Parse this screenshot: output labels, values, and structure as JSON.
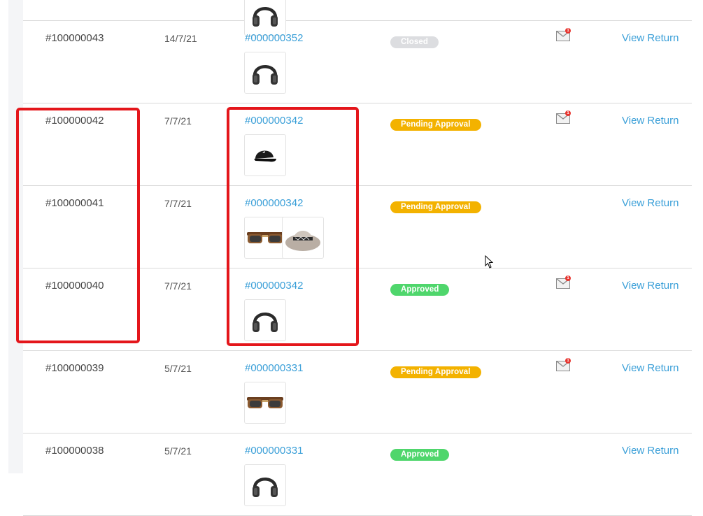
{
  "colors": {
    "link": "#3a9fd8",
    "closed": "#dcdde0",
    "pending": "#f3b200",
    "approved": "#4fd66c",
    "highlight": "#e4161b"
  },
  "rows": [
    {
      "id": "",
      "date": "",
      "order": "",
      "status": "",
      "status_type": "none",
      "mail": false,
      "view": "",
      "products": [
        "headphones-icon"
      ]
    },
    {
      "id": "#100000043",
      "date": "14/7/21",
      "order": "#000000352",
      "status": "Closed",
      "status_type": "closed",
      "mail": true,
      "view": "View Return",
      "products": [
        "headphones-icon"
      ]
    },
    {
      "id": "#100000042",
      "date": "7/7/21",
      "order": "#000000342",
      "status": "Pending Approval",
      "status_type": "pending",
      "mail": true,
      "view": "View Return",
      "products": [
        "cap-icon"
      ]
    },
    {
      "id": "#100000041",
      "date": "7/7/21",
      "order": "#000000342",
      "status": "Pending Approval",
      "status_type": "pending",
      "mail": false,
      "view": "View Return",
      "products": [
        "sunglasses-icon",
        "sun-hat-icon"
      ]
    },
    {
      "id": "#100000040",
      "date": "7/7/21",
      "order": "#000000342",
      "status": "Approved",
      "status_type": "approved",
      "mail": true,
      "view": "View Return",
      "products": [
        "headphones-icon"
      ]
    },
    {
      "id": "#100000039",
      "date": "5/7/21",
      "order": "#000000331",
      "status": "Pending Approval",
      "status_type": "pending",
      "mail": true,
      "view": "View Return",
      "products": [
        "sunglasses-icon"
      ]
    },
    {
      "id": "#100000038",
      "date": "5/7/21",
      "order": "#000000331",
      "status": "Approved",
      "status_type": "approved",
      "mail": false,
      "view": "View Return",
      "products": [
        "headphones-icon"
      ]
    }
  ],
  "mail_badge": "1"
}
